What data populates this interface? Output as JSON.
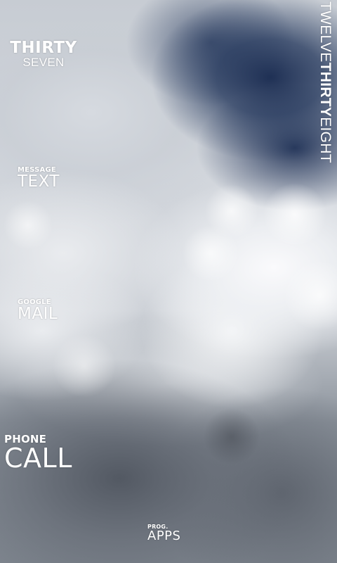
{
  "clock": {
    "hour_word": "TWELVE",
    "minute_word": "THIRTY",
    "next_minute_word": "EIGHT",
    "widget_minute_word": "THIRTY",
    "widget_second_word": "SEVEN"
  },
  "shortcuts": {
    "text": {
      "small": "MESSAGE",
      "big": "TEXT"
    },
    "mail": {
      "small": "GOOGLE",
      "big": "MAIL"
    },
    "call": {
      "small": "PHONE",
      "big": "CALL"
    },
    "apps": {
      "small": "PROG.",
      "big": "APPS"
    }
  },
  "colors": {
    "label_text": "#ffffff",
    "sky_dark": "#16284e",
    "cloud_light": "#f0f2f5",
    "cloud_dark": "#50565f"
  }
}
